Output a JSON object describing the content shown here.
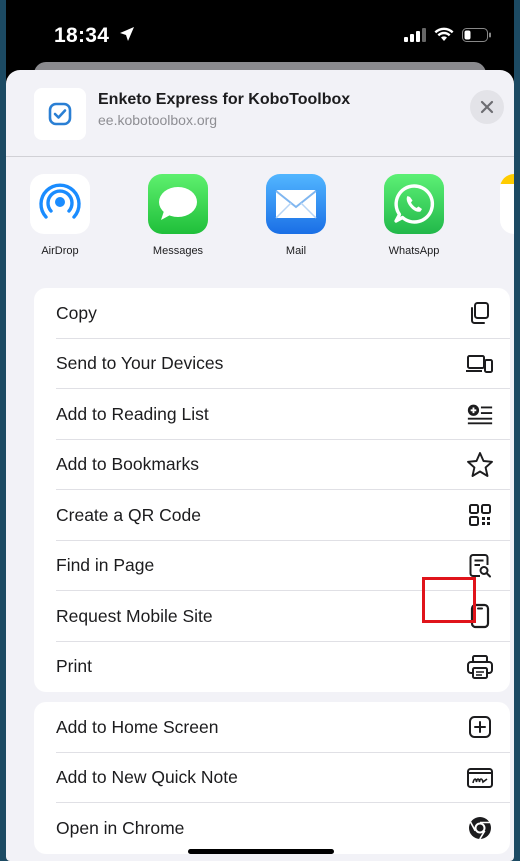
{
  "status": {
    "time": "18:34"
  },
  "header": {
    "title": "Enketo Express for KoboToolbox",
    "url": "ee.kobotoolbox.org"
  },
  "apps": [
    {
      "label": "AirDrop",
      "icon": "airdrop-icon"
    },
    {
      "label": "Messages",
      "icon": "messages-icon"
    },
    {
      "label": "Mail",
      "icon": "mail-icon"
    },
    {
      "label": "WhatsApp",
      "icon": "whatsapp-icon"
    }
  ],
  "actions_primary": [
    {
      "label": "Copy",
      "icon": "copy-icon"
    },
    {
      "label": "Send to Your Devices",
      "icon": "devices-icon"
    },
    {
      "label": "Add to Reading List",
      "icon": "reading-list-icon"
    },
    {
      "label": "Add to Bookmarks",
      "icon": "star-icon"
    },
    {
      "label": "Create a QR Code",
      "icon": "qr-code-icon"
    },
    {
      "label": "Find in Page",
      "icon": "find-in-page-icon"
    },
    {
      "label": "Request Mobile Site",
      "icon": "phone-icon"
    },
    {
      "label": "Print",
      "icon": "printer-icon"
    }
  ],
  "actions_secondary": [
    {
      "label": "Add to Home Screen",
      "icon": "add-square-icon"
    },
    {
      "label": "Add to New Quick Note",
      "icon": "quick-note-icon"
    },
    {
      "label": "Open in Chrome",
      "icon": "chrome-icon"
    }
  ],
  "colors": {
    "messages": "#34c759",
    "mail": "#1a8cff",
    "whatsapp": "#25d366",
    "airdrop": "#1a8cff",
    "highlight": "#e0141b",
    "background": "#f2f2f7"
  }
}
